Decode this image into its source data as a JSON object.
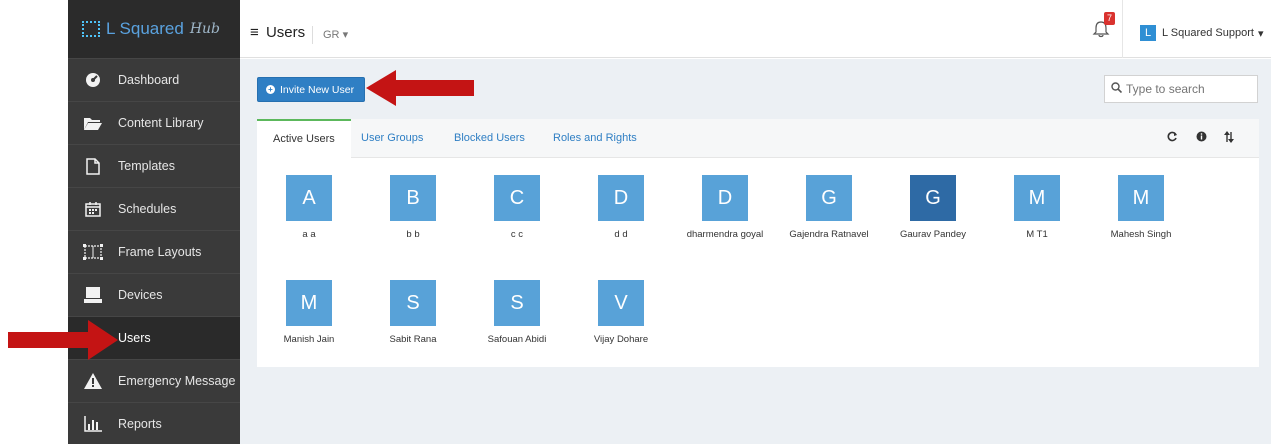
{
  "brand": {
    "name": "L Squared",
    "sub": "Hub"
  },
  "sidebar": {
    "items": [
      {
        "label": "Dashboard",
        "icon": "dashboard-icon"
      },
      {
        "label": "Content Library",
        "icon": "folder-icon"
      },
      {
        "label": "Templates",
        "icon": "file-icon"
      },
      {
        "label": "Schedules",
        "icon": "calendar-icon"
      },
      {
        "label": "Frame Layouts",
        "icon": "layout-icon"
      },
      {
        "label": "Devices",
        "icon": "device-icon"
      },
      {
        "label": "Users",
        "icon": "users-icon",
        "active": true
      },
      {
        "label": "Emergency Message",
        "icon": "warning-icon"
      },
      {
        "label": "Reports",
        "icon": "chart-icon"
      }
    ]
  },
  "header": {
    "title": "Users",
    "gr": "GR",
    "notification_count": "7",
    "user_initial": "L",
    "user_name": "L Squared Support"
  },
  "toolbar": {
    "invite_label": "Invite New User",
    "search_placeholder": "Type to search"
  },
  "tabs": [
    "Active Users",
    "User Groups",
    "Blocked Users",
    "Roles and Rights"
  ],
  "users": [
    {
      "initial": "A",
      "name": "a a"
    },
    {
      "initial": "B",
      "name": "b b"
    },
    {
      "initial": "C",
      "name": "c c"
    },
    {
      "initial": "D",
      "name": "d d"
    },
    {
      "initial": "D",
      "name": "dharmendra goyal"
    },
    {
      "initial": "G",
      "name": "Gajendra Ratnavel"
    },
    {
      "initial": "G",
      "name": "Gaurav Pandey"
    },
    {
      "initial": "M",
      "name": "M T1"
    },
    {
      "initial": "M",
      "name": "Mahesh Singh"
    },
    {
      "initial": "M",
      "name": "Manish Jain"
    },
    {
      "initial": "S",
      "name": "Sabit Rana"
    },
    {
      "initial": "S",
      "name": "Safouan Abidi"
    },
    {
      "initial": "V",
      "name": "Vijay Dohare"
    }
  ],
  "colors": {
    "accent": "#2f7fc4",
    "tile": "#58a2d8",
    "tile_selected": "#2e6aa5",
    "sidebar": "#3a3a3a",
    "annotation_arrow": "#c41414"
  }
}
